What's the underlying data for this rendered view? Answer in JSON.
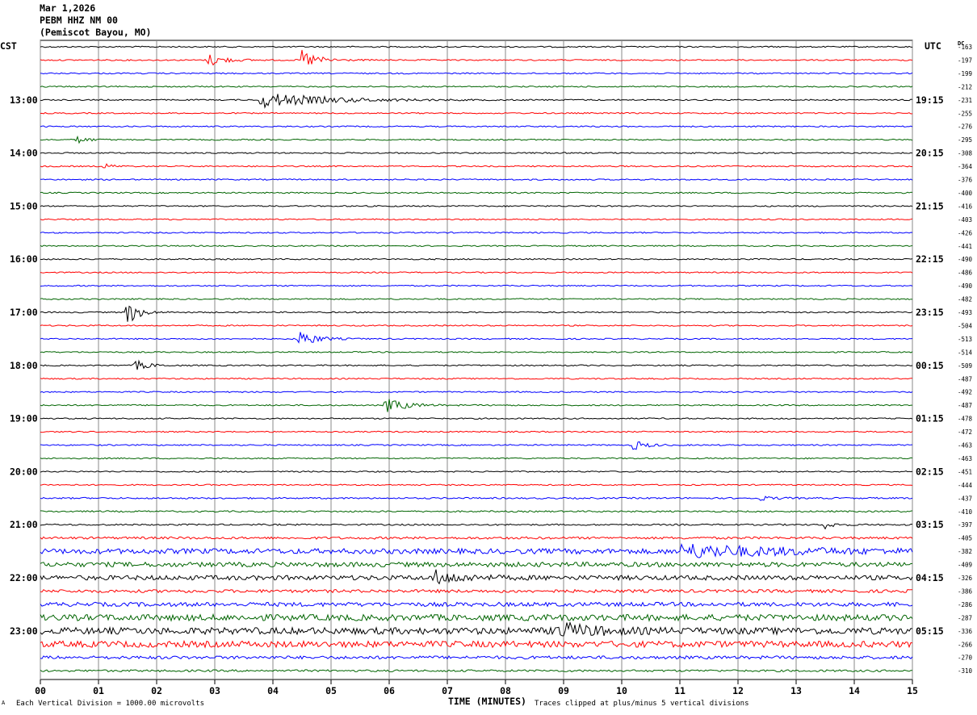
{
  "header": {
    "date": "Mar 1,2026",
    "station": "PEBM HHZ NM 00",
    "location": "(Pemiscot Bayou, MO)"
  },
  "left_tz": "CST",
  "right_tz": "UTC",
  "dc_label": "DC",
  "footer": {
    "scale_mark": "A",
    "scale_note": "Each Vertical Division = 1000.00 microvolts",
    "clip_note": "Traces clipped at plus/minus 5 vertical divisions"
  },
  "chart_data": {
    "type": "line",
    "title": "",
    "xlabel": "TIME (MINUTES)",
    "x_ticks": [
      "00",
      "01",
      "02",
      "03",
      "04",
      "05",
      "06",
      "07",
      "08",
      "09",
      "10",
      "11",
      "12",
      "13",
      "14",
      "15"
    ],
    "xlim": [
      0,
      15
    ],
    "trace_colors": [
      "#000000",
      "#ff0000",
      "#0000ff",
      "#006400"
    ],
    "left_hour_labels": [
      "13:00",
      "14:00",
      "15:00",
      "16:00",
      "17:00",
      "18:00",
      "19:00",
      "20:00",
      "21:00",
      "22:00",
      "23:00"
    ],
    "right_hour_labels": [
      "19:15",
      "20:15",
      "21:15",
      "22:15",
      "23:15",
      "00:15",
      "01:15",
      "02:15",
      "03:15",
      "04:15",
      "05:15"
    ],
    "dc_offsets": [
      "-163",
      "-197",
      "-199",
      "-212",
      "-231",
      "-255",
      "-276",
      "-295",
      "-308",
      "-364",
      "-376",
      "-400",
      "-416",
      "-403",
      "-426",
      "-441",
      "-490",
      "-486",
      "-490",
      "-482",
      "-493",
      "-504",
      "-513",
      "-514",
      "-509",
      "-487",
      "-492",
      "-487",
      "-478",
      "-472",
      "-463",
      "-463",
      "-451",
      "-444",
      "-437",
      "-410",
      "-397",
      "-405",
      "-382",
      "-409",
      "-326",
      "-386",
      "-286",
      "-287",
      "-336",
      "-266",
      "-270",
      "-310"
    ],
    "trace_count": 48,
    "noise_levels": [
      0.5,
      0.5,
      0.5,
      0.5,
      0.5,
      0.5,
      0.5,
      0.5,
      0.5,
      0.5,
      0.5,
      0.5,
      0.5,
      0.5,
      0.5,
      0.5,
      0.5,
      0.5,
      0.5,
      0.5,
      0.5,
      0.5,
      0.5,
      0.5,
      0.5,
      0.5,
      0.5,
      0.5,
      0.5,
      0.5,
      0.5,
      0.5,
      0.5,
      0.5,
      0.6,
      0.6,
      0.6,
      0.9,
      2.0,
      1.8,
      1.8,
      1.2,
      1.6,
      2.4,
      2.6,
      2.4,
      1.2,
      0.8
    ],
    "events": [
      {
        "trace": 1,
        "minute": 2.9,
        "amplitude": 5,
        "duration": 0.5
      },
      {
        "trace": 1,
        "minute": 4.5,
        "amplitude": 8,
        "duration": 0.5
      },
      {
        "trace": 4,
        "minute": 3.8,
        "amplitude": 6,
        "duration": 2.0
      },
      {
        "trace": 7,
        "minute": 0.65,
        "amplitude": 3,
        "duration": 0.3
      },
      {
        "trace": 9,
        "minute": 1.1,
        "amplitude": 2,
        "duration": 0.3
      },
      {
        "trace": 20,
        "minute": 1.5,
        "amplitude": 10,
        "duration": 0.35
      },
      {
        "trace": 22,
        "minute": 4.45,
        "amplitude": 7,
        "duration": 0.5
      },
      {
        "trace": 24,
        "minute": 1.65,
        "amplitude": 4,
        "duration": 0.4
      },
      {
        "trace": 27,
        "minute": 5.95,
        "amplitude": 6,
        "duration": 0.6
      },
      {
        "trace": 30,
        "minute": 10.2,
        "amplitude": 4,
        "duration": 0.4
      },
      {
        "trace": 34,
        "minute": 12.3,
        "amplitude": 2,
        "duration": 0.5
      },
      {
        "trace": 36,
        "minute": 13.5,
        "amplitude": 3,
        "duration": 0.3
      },
      {
        "trace": 38,
        "minute": 11.0,
        "amplitude": 5,
        "duration": 3.0
      },
      {
        "trace": 40,
        "minute": 6.8,
        "amplitude": 5,
        "duration": 0.8
      },
      {
        "trace": 44,
        "minute": 8.9,
        "amplitude": 6,
        "duration": 1.0
      }
    ]
  }
}
